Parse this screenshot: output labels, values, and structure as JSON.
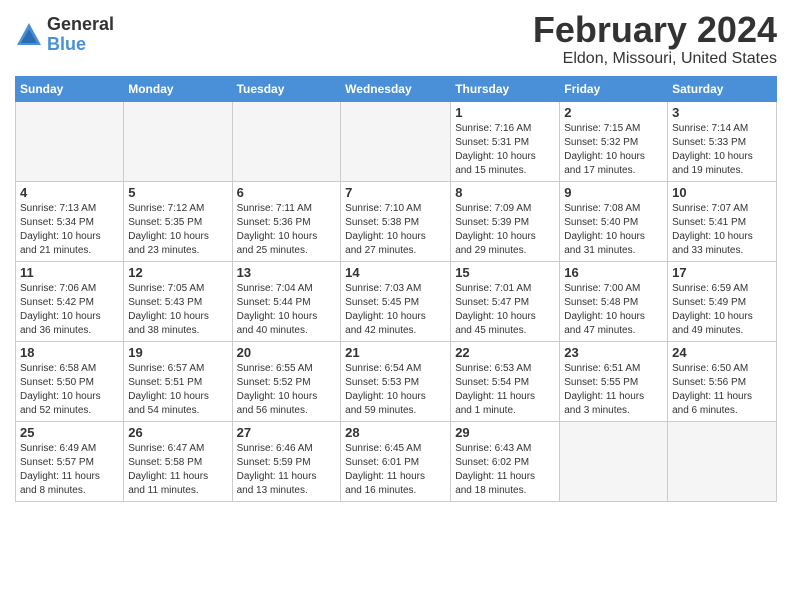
{
  "logo": {
    "general": "General",
    "blue": "Blue"
  },
  "header": {
    "month_year": "February 2024",
    "location": "Eldon, Missouri, United States"
  },
  "weekdays": [
    "Sunday",
    "Monday",
    "Tuesday",
    "Wednesday",
    "Thursday",
    "Friday",
    "Saturday"
  ],
  "weeks": [
    [
      {
        "day": "",
        "info": ""
      },
      {
        "day": "",
        "info": ""
      },
      {
        "day": "",
        "info": ""
      },
      {
        "day": "",
        "info": ""
      },
      {
        "day": "1",
        "info": "Sunrise: 7:16 AM\nSunset: 5:31 PM\nDaylight: 10 hours\nand 15 minutes."
      },
      {
        "day": "2",
        "info": "Sunrise: 7:15 AM\nSunset: 5:32 PM\nDaylight: 10 hours\nand 17 minutes."
      },
      {
        "day": "3",
        "info": "Sunrise: 7:14 AM\nSunset: 5:33 PM\nDaylight: 10 hours\nand 19 minutes."
      }
    ],
    [
      {
        "day": "4",
        "info": "Sunrise: 7:13 AM\nSunset: 5:34 PM\nDaylight: 10 hours\nand 21 minutes."
      },
      {
        "day": "5",
        "info": "Sunrise: 7:12 AM\nSunset: 5:35 PM\nDaylight: 10 hours\nand 23 minutes."
      },
      {
        "day": "6",
        "info": "Sunrise: 7:11 AM\nSunset: 5:36 PM\nDaylight: 10 hours\nand 25 minutes."
      },
      {
        "day": "7",
        "info": "Sunrise: 7:10 AM\nSunset: 5:38 PM\nDaylight: 10 hours\nand 27 minutes."
      },
      {
        "day": "8",
        "info": "Sunrise: 7:09 AM\nSunset: 5:39 PM\nDaylight: 10 hours\nand 29 minutes."
      },
      {
        "day": "9",
        "info": "Sunrise: 7:08 AM\nSunset: 5:40 PM\nDaylight: 10 hours\nand 31 minutes."
      },
      {
        "day": "10",
        "info": "Sunrise: 7:07 AM\nSunset: 5:41 PM\nDaylight: 10 hours\nand 33 minutes."
      }
    ],
    [
      {
        "day": "11",
        "info": "Sunrise: 7:06 AM\nSunset: 5:42 PM\nDaylight: 10 hours\nand 36 minutes."
      },
      {
        "day": "12",
        "info": "Sunrise: 7:05 AM\nSunset: 5:43 PM\nDaylight: 10 hours\nand 38 minutes."
      },
      {
        "day": "13",
        "info": "Sunrise: 7:04 AM\nSunset: 5:44 PM\nDaylight: 10 hours\nand 40 minutes."
      },
      {
        "day": "14",
        "info": "Sunrise: 7:03 AM\nSunset: 5:45 PM\nDaylight: 10 hours\nand 42 minutes."
      },
      {
        "day": "15",
        "info": "Sunrise: 7:01 AM\nSunset: 5:47 PM\nDaylight: 10 hours\nand 45 minutes."
      },
      {
        "day": "16",
        "info": "Sunrise: 7:00 AM\nSunset: 5:48 PM\nDaylight: 10 hours\nand 47 minutes."
      },
      {
        "day": "17",
        "info": "Sunrise: 6:59 AM\nSunset: 5:49 PM\nDaylight: 10 hours\nand 49 minutes."
      }
    ],
    [
      {
        "day": "18",
        "info": "Sunrise: 6:58 AM\nSunset: 5:50 PM\nDaylight: 10 hours\nand 52 minutes."
      },
      {
        "day": "19",
        "info": "Sunrise: 6:57 AM\nSunset: 5:51 PM\nDaylight: 10 hours\nand 54 minutes."
      },
      {
        "day": "20",
        "info": "Sunrise: 6:55 AM\nSunset: 5:52 PM\nDaylight: 10 hours\nand 56 minutes."
      },
      {
        "day": "21",
        "info": "Sunrise: 6:54 AM\nSunset: 5:53 PM\nDaylight: 10 hours\nand 59 minutes."
      },
      {
        "day": "22",
        "info": "Sunrise: 6:53 AM\nSunset: 5:54 PM\nDaylight: 11 hours\nand 1 minute."
      },
      {
        "day": "23",
        "info": "Sunrise: 6:51 AM\nSunset: 5:55 PM\nDaylight: 11 hours\nand 3 minutes."
      },
      {
        "day": "24",
        "info": "Sunrise: 6:50 AM\nSunset: 5:56 PM\nDaylight: 11 hours\nand 6 minutes."
      }
    ],
    [
      {
        "day": "25",
        "info": "Sunrise: 6:49 AM\nSunset: 5:57 PM\nDaylight: 11 hours\nand 8 minutes."
      },
      {
        "day": "26",
        "info": "Sunrise: 6:47 AM\nSunset: 5:58 PM\nDaylight: 11 hours\nand 11 minutes."
      },
      {
        "day": "27",
        "info": "Sunrise: 6:46 AM\nSunset: 5:59 PM\nDaylight: 11 hours\nand 13 minutes."
      },
      {
        "day": "28",
        "info": "Sunrise: 6:45 AM\nSunset: 6:01 PM\nDaylight: 11 hours\nand 16 minutes."
      },
      {
        "day": "29",
        "info": "Sunrise: 6:43 AM\nSunset: 6:02 PM\nDaylight: 11 hours\nand 18 minutes."
      },
      {
        "day": "",
        "info": ""
      },
      {
        "day": "",
        "info": ""
      }
    ]
  ]
}
